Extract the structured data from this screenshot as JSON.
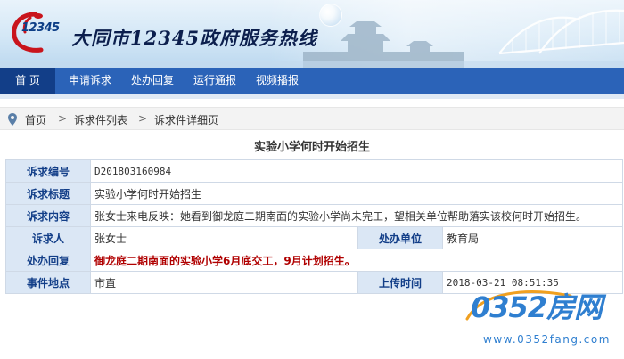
{
  "header": {
    "logo_text": "12345",
    "site_title": "大同市12345政府服务热线"
  },
  "nav": {
    "items": [
      {
        "label": "首 页",
        "active": true
      },
      {
        "label": "申请诉求",
        "active": false
      },
      {
        "label": "处办回复",
        "active": false
      },
      {
        "label": "运行通报",
        "active": false
      },
      {
        "label": "视频播报",
        "active": false
      }
    ]
  },
  "breadcrumb": {
    "items": [
      "首页",
      "诉求件列表",
      "诉求件详细页"
    ],
    "separator": ">"
  },
  "detail": {
    "title": "实验小学何时开始招生",
    "fields": {
      "id_label": "诉求编号",
      "id_value": "D201803160984",
      "subject_label": "诉求标题",
      "subject_value": "实验小学何时开始招生",
      "content_label": "诉求内容",
      "content_value": "张女士来电反映：她看到御龙庭二期南面的实验小学尚未完工，望相关单位帮助落实该校何时开始招生。",
      "person_label": "诉求人",
      "person_value": "张女士",
      "unit_label": "处办单位",
      "unit_value": "教育局",
      "reply_label": "处办回复",
      "reply_value": "御龙庭二期南面的实验小学6月底交工，9月计划招生。",
      "location_label": "事件地点",
      "location_value": "市直",
      "upload_label": "上传时间",
      "upload_value": "2018-03-21 08:51:35"
    }
  },
  "watermark": {
    "logo": "0352房网",
    "url": "www.0352fang.com"
  },
  "colors": {
    "nav_bg": "#2b63b8",
    "nav_active": "#123e88",
    "label_bg": "#dbe7f5",
    "label_text": "#123e88",
    "reply_text": "#b00000",
    "watermark": "#2f7fd0"
  }
}
